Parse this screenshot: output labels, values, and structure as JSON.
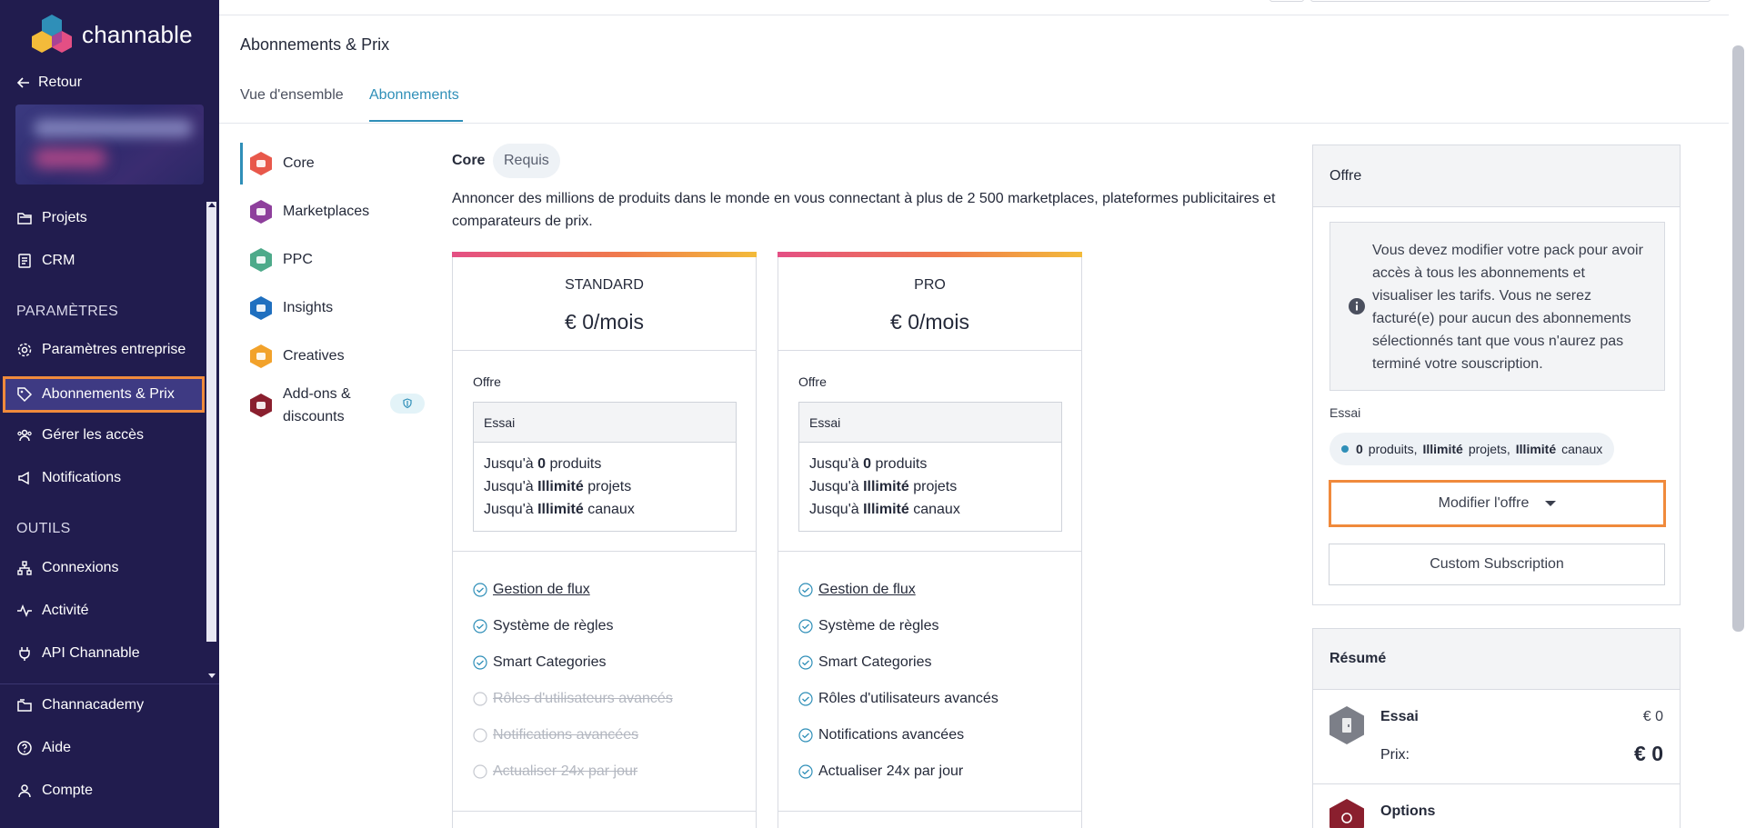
{
  "sidebar": {
    "logo_text": "channable",
    "back_label": "Retour",
    "items_top": [
      {
        "label": "Projets",
        "icon": "projects-icon"
      },
      {
        "label": "CRM",
        "icon": "crm-icon"
      }
    ],
    "section_parametres": "PARAMÈTRES",
    "items_parametres": [
      {
        "label": "Paramètres entreprise",
        "icon": "gear-icon"
      },
      {
        "label": "Abonnements & Prix",
        "icon": "tag-icon",
        "active": true
      },
      {
        "label": "Gérer les accès",
        "icon": "users-icon"
      },
      {
        "label": "Notifications",
        "icon": "megaphone-icon"
      }
    ],
    "section_outils": "OUTILS",
    "items_outils": [
      {
        "label": "Connexions",
        "icon": "network-icon"
      },
      {
        "label": "Activité",
        "icon": "activity-icon"
      },
      {
        "label": "API Channable",
        "icon": "plug-icon"
      }
    ],
    "items_bottom": [
      {
        "label": "Channacademy",
        "icon": "academy-icon"
      },
      {
        "label": "Aide",
        "icon": "help-icon"
      },
      {
        "label": "Compte",
        "icon": "user-icon"
      }
    ]
  },
  "header": {
    "page_title": "Abonnements & Prix",
    "tabs": [
      {
        "label": "Vue d'ensemble",
        "active": false
      },
      {
        "label": "Abonnements",
        "active": true
      }
    ]
  },
  "subnav": {
    "items": [
      {
        "label": "Core",
        "color": "#e8584b",
        "active": true
      },
      {
        "label": "Marketplaces",
        "color": "#8e3f9c"
      },
      {
        "label": "PPC",
        "color": "#4daa8a"
      },
      {
        "label": "Insights",
        "color": "#1f6fbf"
      },
      {
        "label": "Creatives",
        "color": "#f2a22b"
      },
      {
        "label_line1": "Add-ons &",
        "label_line2": "discounts",
        "color": "#8a1f2e"
      }
    ]
  },
  "content": {
    "section_title": "Core",
    "section_badge": "Requis",
    "description": "Annoncer des millions de produits dans le monde en vous connectant à plus de 2 500 marketplaces, plateformes publicitaires et comparateurs de prix.",
    "plans": [
      {
        "name": "STANDARD",
        "price": "€ 0/mois",
        "offre_label": "Offre",
        "offre_box_title": "Essai",
        "limits": [
          {
            "prefix": "Jusqu'à ",
            "value": "0",
            "suffix": " produits"
          },
          {
            "prefix": "Jusqu'à ",
            "value": "Illimité",
            "suffix": " projets"
          },
          {
            "prefix": "Jusqu'à ",
            "value": "Illimité",
            "suffix": " canaux"
          }
        ],
        "features": [
          {
            "label": "Gestion de flux",
            "included": true,
            "link": true
          },
          {
            "label": "Système de règles",
            "included": true
          },
          {
            "label": "Smart Categories",
            "included": true
          },
          {
            "label": "Rôles d'utilisateurs avancés",
            "included": false
          },
          {
            "label": "Notifications avancées",
            "included": false
          },
          {
            "label": "Actualiser 24x par jour",
            "included": false
          }
        ]
      },
      {
        "name": "PRO",
        "price": "€ 0/mois",
        "offre_label": "Offre",
        "offre_box_title": "Essai",
        "limits": [
          {
            "prefix": "Jusqu'à ",
            "value": "0",
            "suffix": " produits"
          },
          {
            "prefix": "Jusqu'à ",
            "value": "Illimité",
            "suffix": " projets"
          },
          {
            "prefix": "Jusqu'à ",
            "value": "Illimité",
            "suffix": " canaux"
          }
        ],
        "features": [
          {
            "label": "Gestion de flux",
            "included": true,
            "link": true
          },
          {
            "label": "Système de règles",
            "included": true
          },
          {
            "label": "Smart Categories",
            "included": true
          },
          {
            "label": "Rôles d'utilisateurs avancés",
            "included": true
          },
          {
            "label": "Notifications avancées",
            "included": true
          },
          {
            "label": "Actualiser 24x par jour",
            "included": true
          }
        ]
      }
    ]
  },
  "offer_panel": {
    "title": "Offre",
    "info_text": "Vous devez modifier votre pack pour avoir accès à tous les abonnements et visualiser les tarifs. Vous ne serez facturé(e) pour aucun des abonnements sélectionnés tant que vous n'aurez pas terminé votre souscription.",
    "essai_label": "Essai",
    "pill": {
      "products_value": "0",
      "products_label": "produits,",
      "projects_value": "Illimité",
      "projects_label": "projets,",
      "channels_value": "Illimité",
      "channels_label": "canaux"
    },
    "modify_button": "Modifier l'offre",
    "custom_button": "Custom Subscription"
  },
  "summary_panel": {
    "title": "Résumé",
    "items": [
      {
        "name": "Essai",
        "value": "€ 0",
        "price_label": "Prix:",
        "price": "€ 0"
      },
      {
        "name": "Options"
      }
    ]
  },
  "colors": {
    "sidebar_bg": "#211c4e",
    "accent": "#2f8fb8",
    "highlight_outline": "#f08a3c"
  }
}
